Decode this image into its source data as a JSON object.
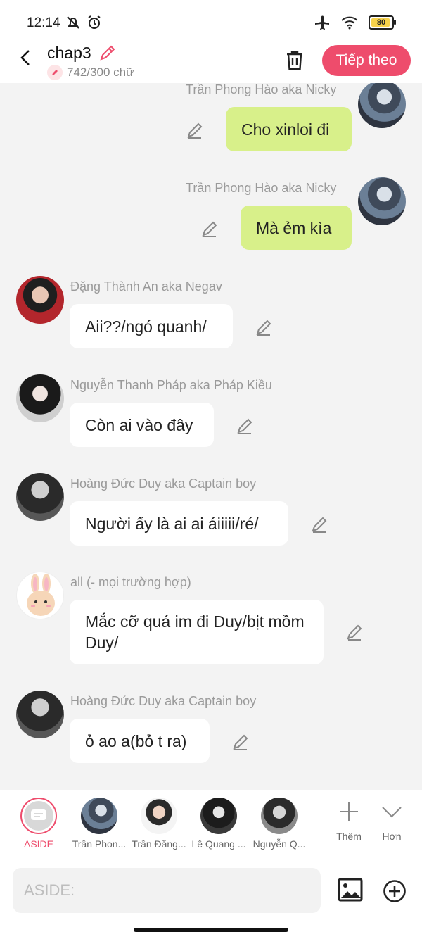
{
  "status_bar": {
    "time": "12:14",
    "battery": "80",
    "icons": [
      "mute-icon",
      "alarm-icon",
      "airplane-icon",
      "wifi-icon",
      "battery-icon"
    ]
  },
  "header": {
    "title": "chap3",
    "word_count": "742/300 chữ",
    "next_label": "Tiếp theo",
    "accent_color": "#ee4c6c"
  },
  "messages": [
    {
      "sender": "Trần Phong Hào aka Nicky",
      "text": "Cho xinloi đi",
      "own": true
    },
    {
      "sender": "Trần Phong Hào aka Nicky",
      "text": "Mà ẻm kìa",
      "own": true
    },
    {
      "sender": "Đặng Thành An aka Negav",
      "text": "Aii??/ngó quanh/",
      "own": false
    },
    {
      "sender": "Nguyễn Thanh Pháp aka Pháp Kiều",
      "text": "Còn ai vào đây",
      "own": false
    },
    {
      "sender": "Hoàng Đức Duy aka Captain boy",
      "text": "Người ấy là ai ai áiiiii/ré/",
      "own": false
    },
    {
      "sender": "all (- mọi trường hợp)",
      "text": "Mắc cỡ quá im đi Duy/bịt mồm Duy/",
      "own": false
    },
    {
      "sender": "Hoàng Đức Duy aka Captain boy",
      "text": "ỏ ao a(bỏ t ra)",
      "own": false
    }
  ],
  "character_bar": {
    "aside_label": "ASIDE",
    "characters": [
      "Trần Phon...",
      "Trần Đăng...",
      "Lê Quang ...",
      "Nguyễn Q..."
    ],
    "more_label": "Thêm",
    "less_label": "Hơn"
  },
  "input": {
    "placeholder": "ASIDE:"
  }
}
